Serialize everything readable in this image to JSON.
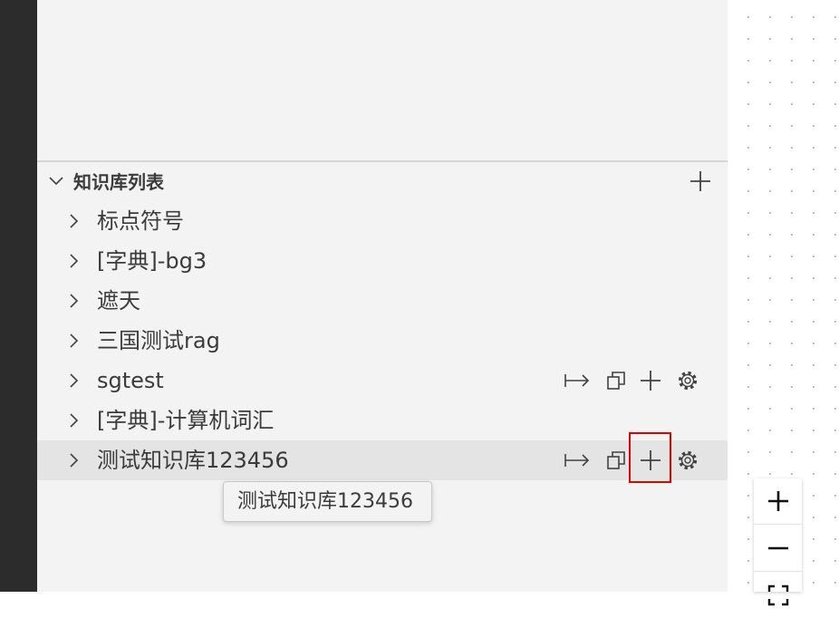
{
  "explorer": {
    "section_title": "知识库列表",
    "items": [
      {
        "label": "标点符号"
      },
      {
        "label": "[字典]-bg3"
      },
      {
        "label": "遮天"
      },
      {
        "label": "三国测试rag"
      },
      {
        "label": "sgtest"
      },
      {
        "label": "[字典]-计算机词汇"
      },
      {
        "label": "测试知识库123456"
      }
    ],
    "tooltip": "测试知识库123456",
    "item_action_icons": [
      "open-arrow-icon",
      "copy-icon",
      "add-icon",
      "gear-icon"
    ],
    "highlight_color": "#e00000"
  },
  "zoom_controls": {
    "icons": [
      "plus-icon",
      "minus-icon",
      "fit-view-icon"
    ]
  }
}
